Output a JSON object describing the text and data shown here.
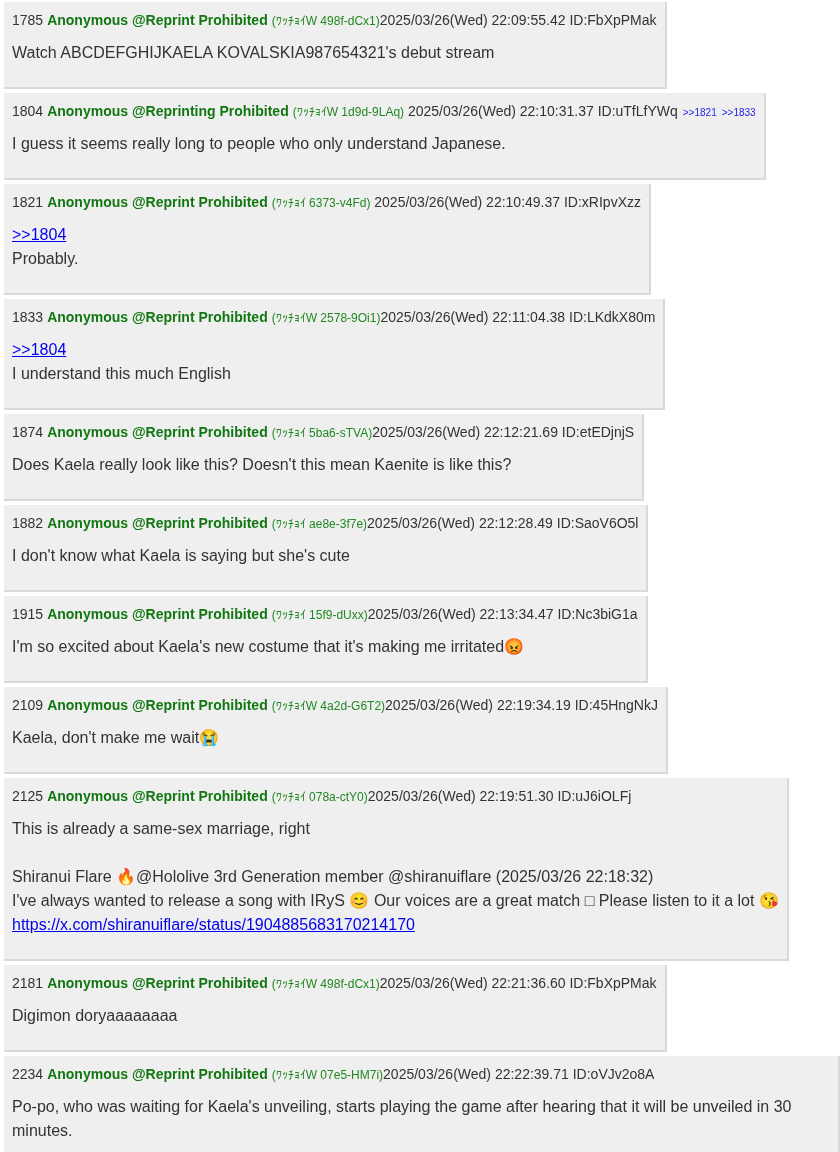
{
  "posts": [
    {
      "number": "1785",
      "name": "Anonymous @Reprint Prohibited",
      "trip": "(ﾜｯﾁｮｲW 498f-dCx1)",
      "date_id": "2025/03/26(Wed) 22:09:55.42 ID:FbXpPMak",
      "body": [
        {
          "kind": "text",
          "text": "Watch ABCDEFGHIJKAELA KOVALSKIA987654321's debut stream"
        }
      ]
    },
    {
      "number": "1804",
      "name": "Anonymous @Reprinting Prohibited",
      "trip": "(ﾜｯﾁｮｲW 1d9d-9LAq)",
      "date_id": " 2025/03/26(Wed) 22:10:31.37 ID:uTfLfYWq",
      "replies": [
        ">>1821",
        ">>1833"
      ],
      "body": [
        {
          "kind": "text",
          "text": "I guess it seems really long to people who only understand Japanese."
        }
      ]
    },
    {
      "number": "1821",
      "name": "Anonymous @Reprint Prohibited",
      "trip": "(ﾜｯﾁｮｲ 6373-v4Fd)",
      "date_id": " 2025/03/26(Wed) 22:10:49.37 ID:xRIpvXzz",
      "body": [
        {
          "kind": "quote",
          "text": ">>1804"
        },
        {
          "kind": "text",
          "text": "Probably."
        }
      ]
    },
    {
      "number": "1833",
      "name": "Anonymous @Reprint Prohibited",
      "trip": "(ﾜｯﾁｮｲW 2578-9Oi1)",
      "date_id": "2025/03/26(Wed) 22:11:04.38 ID:LKdkX80m",
      "body": [
        {
          "kind": "quote",
          "text": ">>1804"
        },
        {
          "kind": "text",
          "text": "I understand this much English"
        }
      ]
    },
    {
      "number": "1874",
      "name": "Anonymous @Reprint Prohibited",
      "trip": "(ﾜｯﾁｮｲ 5ba6-sTVA)",
      "date_id": "2025/03/26(Wed) 22:12:21.69 ID:etEDjnjS",
      "body": [
        {
          "kind": "text",
          "text": "Does Kaela really look like this? Doesn't this mean Kaenite is like this?"
        }
      ]
    },
    {
      "number": "1882",
      "name": "Anonymous @Reprint Prohibited",
      "trip": "(ﾜｯﾁｮｲ ae8e-3f7e)",
      "date_id": "2025/03/26(Wed) 22:12:28.49 ID:SaoV6O5l",
      "body": [
        {
          "kind": "text",
          "text": "I don't know what Kaela is saying but she's cute"
        }
      ]
    },
    {
      "number": "1915",
      "name": "Anonymous @Reprint Prohibited",
      "trip": "(ﾜｯﾁｮｲ 15f9-dUxx)",
      "date_id": "2025/03/26(Wed) 22:13:34.47 ID:Nc3biG1a",
      "body": [
        {
          "kind": "text",
          "text": "I'm so excited about Kaela's new costume that it's making me irritated😡"
        }
      ]
    },
    {
      "number": "2109",
      "name": "Anonymous @Reprint Prohibited",
      "trip": "(ﾜｯﾁｮｲW 4a2d-G6T2)",
      "date_id": "2025/03/26(Wed) 22:19:34.19 ID:45HngNkJ",
      "body": [
        {
          "kind": "text",
          "text": "Kaela, don't make me wait😭"
        }
      ]
    },
    {
      "number": "2125",
      "name": "Anonymous @Reprint Prohibited",
      "trip": "(ﾜｯﾁｮｲ 078a-ctY0)",
      "date_id": "2025/03/26(Wed) 22:19:51.30 ID:uJ6iOLFj",
      "body": [
        {
          "kind": "text",
          "text": "This is already a same-sex marriage, right"
        },
        {
          "kind": "blank"
        },
        {
          "kind": "text",
          "text": "Shiranui Flare 🔥@Hololive 3rd Generation member @shiranuiflare (2025/03/26 22:18:32)"
        },
        {
          "kind": "text",
          "text": "I've always wanted to release a song with IRyS 😊 Our voices are a great match □ Please listen to it a lot 😘"
        },
        {
          "kind": "link",
          "text": "https://x.com/shiranuiflare/status/1904885683170214170"
        }
      ]
    },
    {
      "number": "2181",
      "name": "Anonymous @Reprint Prohibited",
      "trip": "(ﾜｯﾁｮｲW 498f-dCx1)",
      "date_id": "2025/03/26(Wed) 22:21:36.60 ID:FbXpPMak",
      "body": [
        {
          "kind": "text",
          "text": "Digimon doryaaaaaaaa"
        }
      ]
    },
    {
      "number": "2234",
      "name": "Anonymous @Reprint Prohibited",
      "trip": "(ﾜｯﾁｮｲW 07e5-HM7i)",
      "date_id": "2025/03/26(Wed) 22:22:39.71 ID:oVJv2o8A",
      "body": [
        {
          "kind": "text",
          "text": "Po-po, who was waiting for Kaela's unveiling, starts playing the game after hearing that it will be unveiled in 30 minutes."
        }
      ]
    }
  ]
}
